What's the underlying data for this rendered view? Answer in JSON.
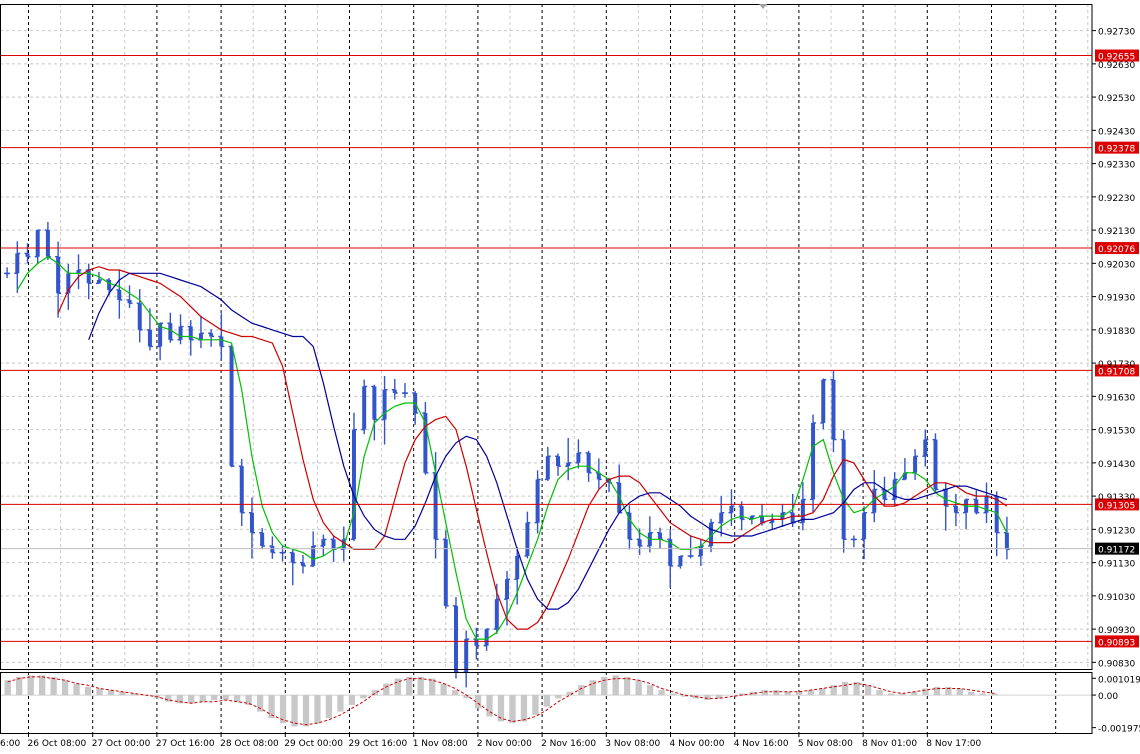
{
  "chart_data": [
    {
      "type": "line",
      "subtype": "ohlc-price-chart",
      "xlabel": "",
      "ylabel": "",
      "x_tick_labels": [
        "26 Oct 08:00",
        "27 Oct 00:00",
        "27 Oct 16:00",
        "28 Oct 08:00",
        "29 Oct 00:00",
        "29 Oct 16:00",
        "1 Nov 08:00",
        "2 Nov 00:00",
        "2 Nov 16:00",
        "3 Nov 08:00",
        "4 Nov 00:00",
        "4 Nov 16:00",
        "5 Nov 08:00",
        "8 Nov 01:00",
        "8 Nov 17:00"
      ],
      "x_first_partial_label": "6:00",
      "y_tick_labels": [
        "0.92730",
        "0.92630",
        "0.92530",
        "0.92430",
        "0.92330",
        "0.92230",
        "0.92130",
        "0.92030",
        "0.91930",
        "0.91830",
        "0.91730",
        "0.91630",
        "0.91530",
        "0.91430",
        "0.91330",
        "0.91230",
        "0.91130",
        "0.91030",
        "0.90930",
        "0.90830"
      ],
      "ylim": [
        0.9081,
        0.9281
      ],
      "grid": true,
      "level_lines": [
        {
          "label": "0.92655",
          "value": 0.92655
        },
        {
          "label": "0.92378",
          "value": 0.92378
        },
        {
          "label": "0.92076",
          "value": 0.92076
        },
        {
          "label": "0.91708",
          "value": 0.91708
        },
        {
          "label": "0.91305",
          "value": 0.91305
        },
        {
          "label": "0.90893",
          "value": 0.90893
        }
      ],
      "current_price": {
        "label": "0.91172",
        "value": 0.91172
      },
      "series": [
        {
          "values": [
            0.92,
            0.9206,
            0.9205,
            0.9213,
            0.9205,
            0.9194,
            0.92,
            0.9201,
            0.9197,
            0.9198,
            0.9195,
            0.9192,
            0.9191,
            0.9183,
            0.9178,
            0.9185,
            0.918,
            0.9184,
            0.918,
            0.9182,
            0.9181,
            0.9178,
            0.9142,
            0.9128,
            0.9122,
            0.9118,
            0.9116,
            0.9116,
            0.9113,
            0.9112,
            0.9118,
            0.912,
            0.9117,
            0.912,
            0.9153,
            0.9166,
            0.9156,
            0.9165,
            0.9164,
            0.9164,
            0.9158,
            0.914,
            0.912,
            0.91,
            0.908,
            0.909,
            0.9088,
            0.9093,
            0.9102,
            0.9108,
            0.9115,
            0.9125,
            0.9138,
            0.9145,
            0.9142,
            0.9143,
            0.9146,
            0.914,
            0.9138,
            0.9137,
            0.9128,
            0.912,
            0.9118,
            0.9122,
            0.912,
            0.9112,
            0.9115,
            0.9115,
            0.9118,
            0.9125,
            0.9128,
            0.913,
            0.9126,
            0.9127,
            0.9125,
            0.9126,
            0.9128,
            0.9125,
            0.9132,
            0.9155,
            0.9168,
            0.915,
            0.912,
            0.912,
            0.9128,
            0.9135,
            0.9132,
            0.9138,
            0.914,
            0.9145,
            0.915,
            0.9135,
            0.913,
            0.9128,
            0.9132,
            0.9128,
            0.9133,
            0.9122,
            0.9117
          ],
          "color": "#3355cc"
        },
        {
          "values": [
            0.9195,
            0.92,
            0.9203,
            0.9205,
            0.9203,
            0.92,
            0.92,
            0.92,
            0.9199,
            0.9197,
            0.9196,
            0.9194,
            0.9192,
            0.9188,
            0.9184,
            0.9183,
            0.9181,
            0.9181,
            0.918,
            0.918,
            0.918,
            0.9179,
            0.9165,
            0.9145,
            0.913,
            0.9122,
            0.9118,
            0.9117,
            0.9116,
            0.9114,
            0.9115,
            0.9117,
            0.9118,
            0.9128,
            0.9145,
            0.9155,
            0.9158,
            0.916,
            0.9161,
            0.9161,
            0.9155,
            0.914,
            0.9125,
            0.911,
            0.9096,
            0.909,
            0.909,
            0.9092,
            0.9097,
            0.9104,
            0.9112,
            0.912,
            0.913,
            0.9138,
            0.9141,
            0.9142,
            0.9142,
            0.914,
            0.9138,
            0.9133,
            0.9126,
            0.9122,
            0.912,
            0.912,
            0.9119,
            0.9117,
            0.9117,
            0.9118,
            0.9121,
            0.9124,
            0.9126,
            0.9127,
            0.9126,
            0.9127,
            0.9127,
            0.9127,
            0.9129,
            0.9138,
            0.9148,
            0.915,
            0.914,
            0.9132,
            0.9128,
            0.9129,
            0.9132,
            0.9134,
            0.9136,
            0.914,
            0.914,
            0.9138,
            0.9134,
            0.9132,
            0.9131,
            0.913,
            0.913,
            0.9129,
            0.9128,
            0.9122
          ],
          "color": "#00c000"
        },
        {
          "values": [
            0.9188,
            0.9195,
            0.9199,
            0.9201,
            0.9202,
            0.9201,
            0.9201,
            0.92,
            0.9199,
            0.9198,
            0.9197,
            0.9195,
            0.9193,
            0.919,
            0.9187,
            0.9185,
            0.9183,
            0.9182,
            0.9181,
            0.9181,
            0.918,
            0.9179,
            0.9172,
            0.9158,
            0.9144,
            0.9132,
            0.9125,
            0.9121,
            0.9119,
            0.9117,
            0.9117,
            0.9117,
            0.9121,
            0.9132,
            0.9143,
            0.915,
            0.9154,
            0.9156,
            0.9157,
            0.9153,
            0.9142,
            0.9129,
            0.9116,
            0.9104,
            0.9096,
            0.9093,
            0.9093,
            0.9095,
            0.91,
            0.9107,
            0.9114,
            0.9122,
            0.913,
            0.9135,
            0.9138,
            0.9139,
            0.9139,
            0.9137,
            0.9133,
            0.9129,
            0.9125,
            0.9123,
            0.9121,
            0.912,
            0.9119,
            0.9119,
            0.9119,
            0.9121,
            0.9123,
            0.9125,
            0.9126,
            0.9126,
            0.9127,
            0.9127,
            0.9128,
            0.9132,
            0.9139,
            0.9144,
            0.9143,
            0.9138,
            0.9133,
            0.913,
            0.913,
            0.9131,
            0.9133,
            0.9135,
            0.9137,
            0.9137,
            0.9136,
            0.9134,
            0.9133,
            0.9133,
            0.9132,
            0.913
          ],
          "color": "#cc0000"
        },
        {
          "values": [
            0.918,
            0.9188,
            0.9194,
            0.9198,
            0.92,
            0.92,
            0.92,
            0.92,
            0.9199,
            0.9198,
            0.9197,
            0.9196,
            0.9194,
            0.9192,
            0.9189,
            0.9187,
            0.9185,
            0.9184,
            0.9183,
            0.9182,
            0.9181,
            0.9181,
            0.9178,
            0.9167,
            0.9154,
            0.9142,
            0.9133,
            0.9127,
            0.9123,
            0.9121,
            0.912,
            0.912,
            0.9124,
            0.9131,
            0.9139,
            0.9145,
            0.9149,
            0.9151,
            0.915,
            0.9145,
            0.9137,
            0.9127,
            0.9117,
            0.9108,
            0.9102,
            0.9099,
            0.9099,
            0.9101,
            0.9105,
            0.9111,
            0.9117,
            0.9123,
            0.9128,
            0.9131,
            0.9133,
            0.9134,
            0.9134,
            0.9132,
            0.913,
            0.9127,
            0.9125,
            0.9123,
            0.9122,
            0.9121,
            0.9121,
            0.9121,
            0.9122,
            0.9123,
            0.9124,
            0.9125,
            0.9126,
            0.9126,
            0.9127,
            0.9128,
            0.9131,
            0.9135,
            0.9137,
            0.9137,
            0.9135,
            0.9133,
            0.9132,
            0.9132,
            0.9133,
            0.9134,
            0.9135,
            0.9136,
            0.9136,
            0.9135,
            0.9134,
            0.9133,
            0.9132
          ],
          "color": "#000099"
        }
      ]
    },
    {
      "type": "area",
      "subtype": "oscillator",
      "y_tick_labels": [
        "0.001019",
        "0.00",
        "-0.001975"
      ],
      "ylim": [
        -0.0023,
        0.0014
      ],
      "grid": false,
      "series": [
        {
          "values": [
            0.0009,
            0.0011,
            0.0012,
            0.0012,
            0.0011,
            0.0009,
            0.0007,
            0.0005,
            0.0004,
            0.0003,
            0.0002,
            0.0001,
            0.0,
            -0.0002,
            -0.0004,
            -0.0005,
            -0.0005,
            -0.0004,
            -0.0003,
            -0.0003,
            -0.0004,
            -0.0006,
            -0.001,
            -0.0014,
            -0.0017,
            -0.0019,
            -0.0019,
            -0.0017,
            -0.0014,
            -0.001,
            -0.0006,
            -0.0002,
            0.0003,
            0.0007,
            0.001,
            0.0011,
            0.0011,
            0.001,
            0.0007,
            0.0003,
            -0.0002,
            -0.0008,
            -0.0013,
            -0.0016,
            -0.0017,
            -0.0016,
            -0.0012,
            -0.0007,
            -0.0002,
            0.0002,
            0.0006,
            0.0009,
            0.0011,
            0.0012,
            0.0011,
            0.0009,
            0.0006,
            0.0003,
            0.0001,
            -0.0001,
            -0.0002,
            -0.0003,
            -0.0002,
            0.0,
            0.0001,
            0.0002,
            0.0003,
            0.0003,
            0.0002,
            0.0002,
            0.0003,
            0.0004,
            0.0006,
            0.0008,
            0.0008,
            0.0006,
            0.0003,
            0.0001,
            0.0001,
            0.0002,
            0.0004,
            0.0005,
            0.0005,
            0.0004,
            0.0002,
            0.0001,
            0.0001
          ],
          "color": "#c8c8c8"
        },
        {
          "values": [
            0.0008,
            0.001,
            0.0011,
            0.0011,
            0.001,
            0.0009,
            0.0007,
            0.0006,
            0.0004,
            0.0003,
            0.0002,
            0.0001,
            0.0,
            -0.0001,
            -0.0003,
            -0.0004,
            -0.0005,
            -0.0004,
            -0.0004,
            -0.0003,
            -0.0004,
            -0.0005,
            -0.0008,
            -0.0012,
            -0.0015,
            -0.0017,
            -0.0018,
            -0.0017,
            -0.0015,
            -0.0012,
            -0.0008,
            -0.0004,
            0.0001,
            0.0005,
            0.0008,
            0.001,
            0.001,
            0.0009,
            0.0007,
            0.0004,
            0.0,
            -0.0005,
            -0.001,
            -0.0014,
            -0.0016,
            -0.0015,
            -0.0013,
            -0.0009,
            -0.0004,
            0.0,
            0.0004,
            0.0007,
            0.0009,
            0.001,
            0.001,
            0.0009,
            0.0007,
            0.0004,
            0.0002,
            0.0,
            -0.0001,
            -0.0002,
            -0.0002,
            -0.0001,
            0.0,
            0.0001,
            0.0002,
            0.0002,
            0.0002,
            0.0002,
            0.0003,
            0.0004,
            0.0005,
            0.0006,
            0.0007,
            0.0006,
            0.0004,
            0.0002,
            0.0001,
            0.0002,
            0.0003,
            0.0004,
            0.0004,
            0.0004,
            0.0003,
            0.0002,
            0.0001
          ],
          "color": "#cc0000"
        }
      ]
    }
  ]
}
